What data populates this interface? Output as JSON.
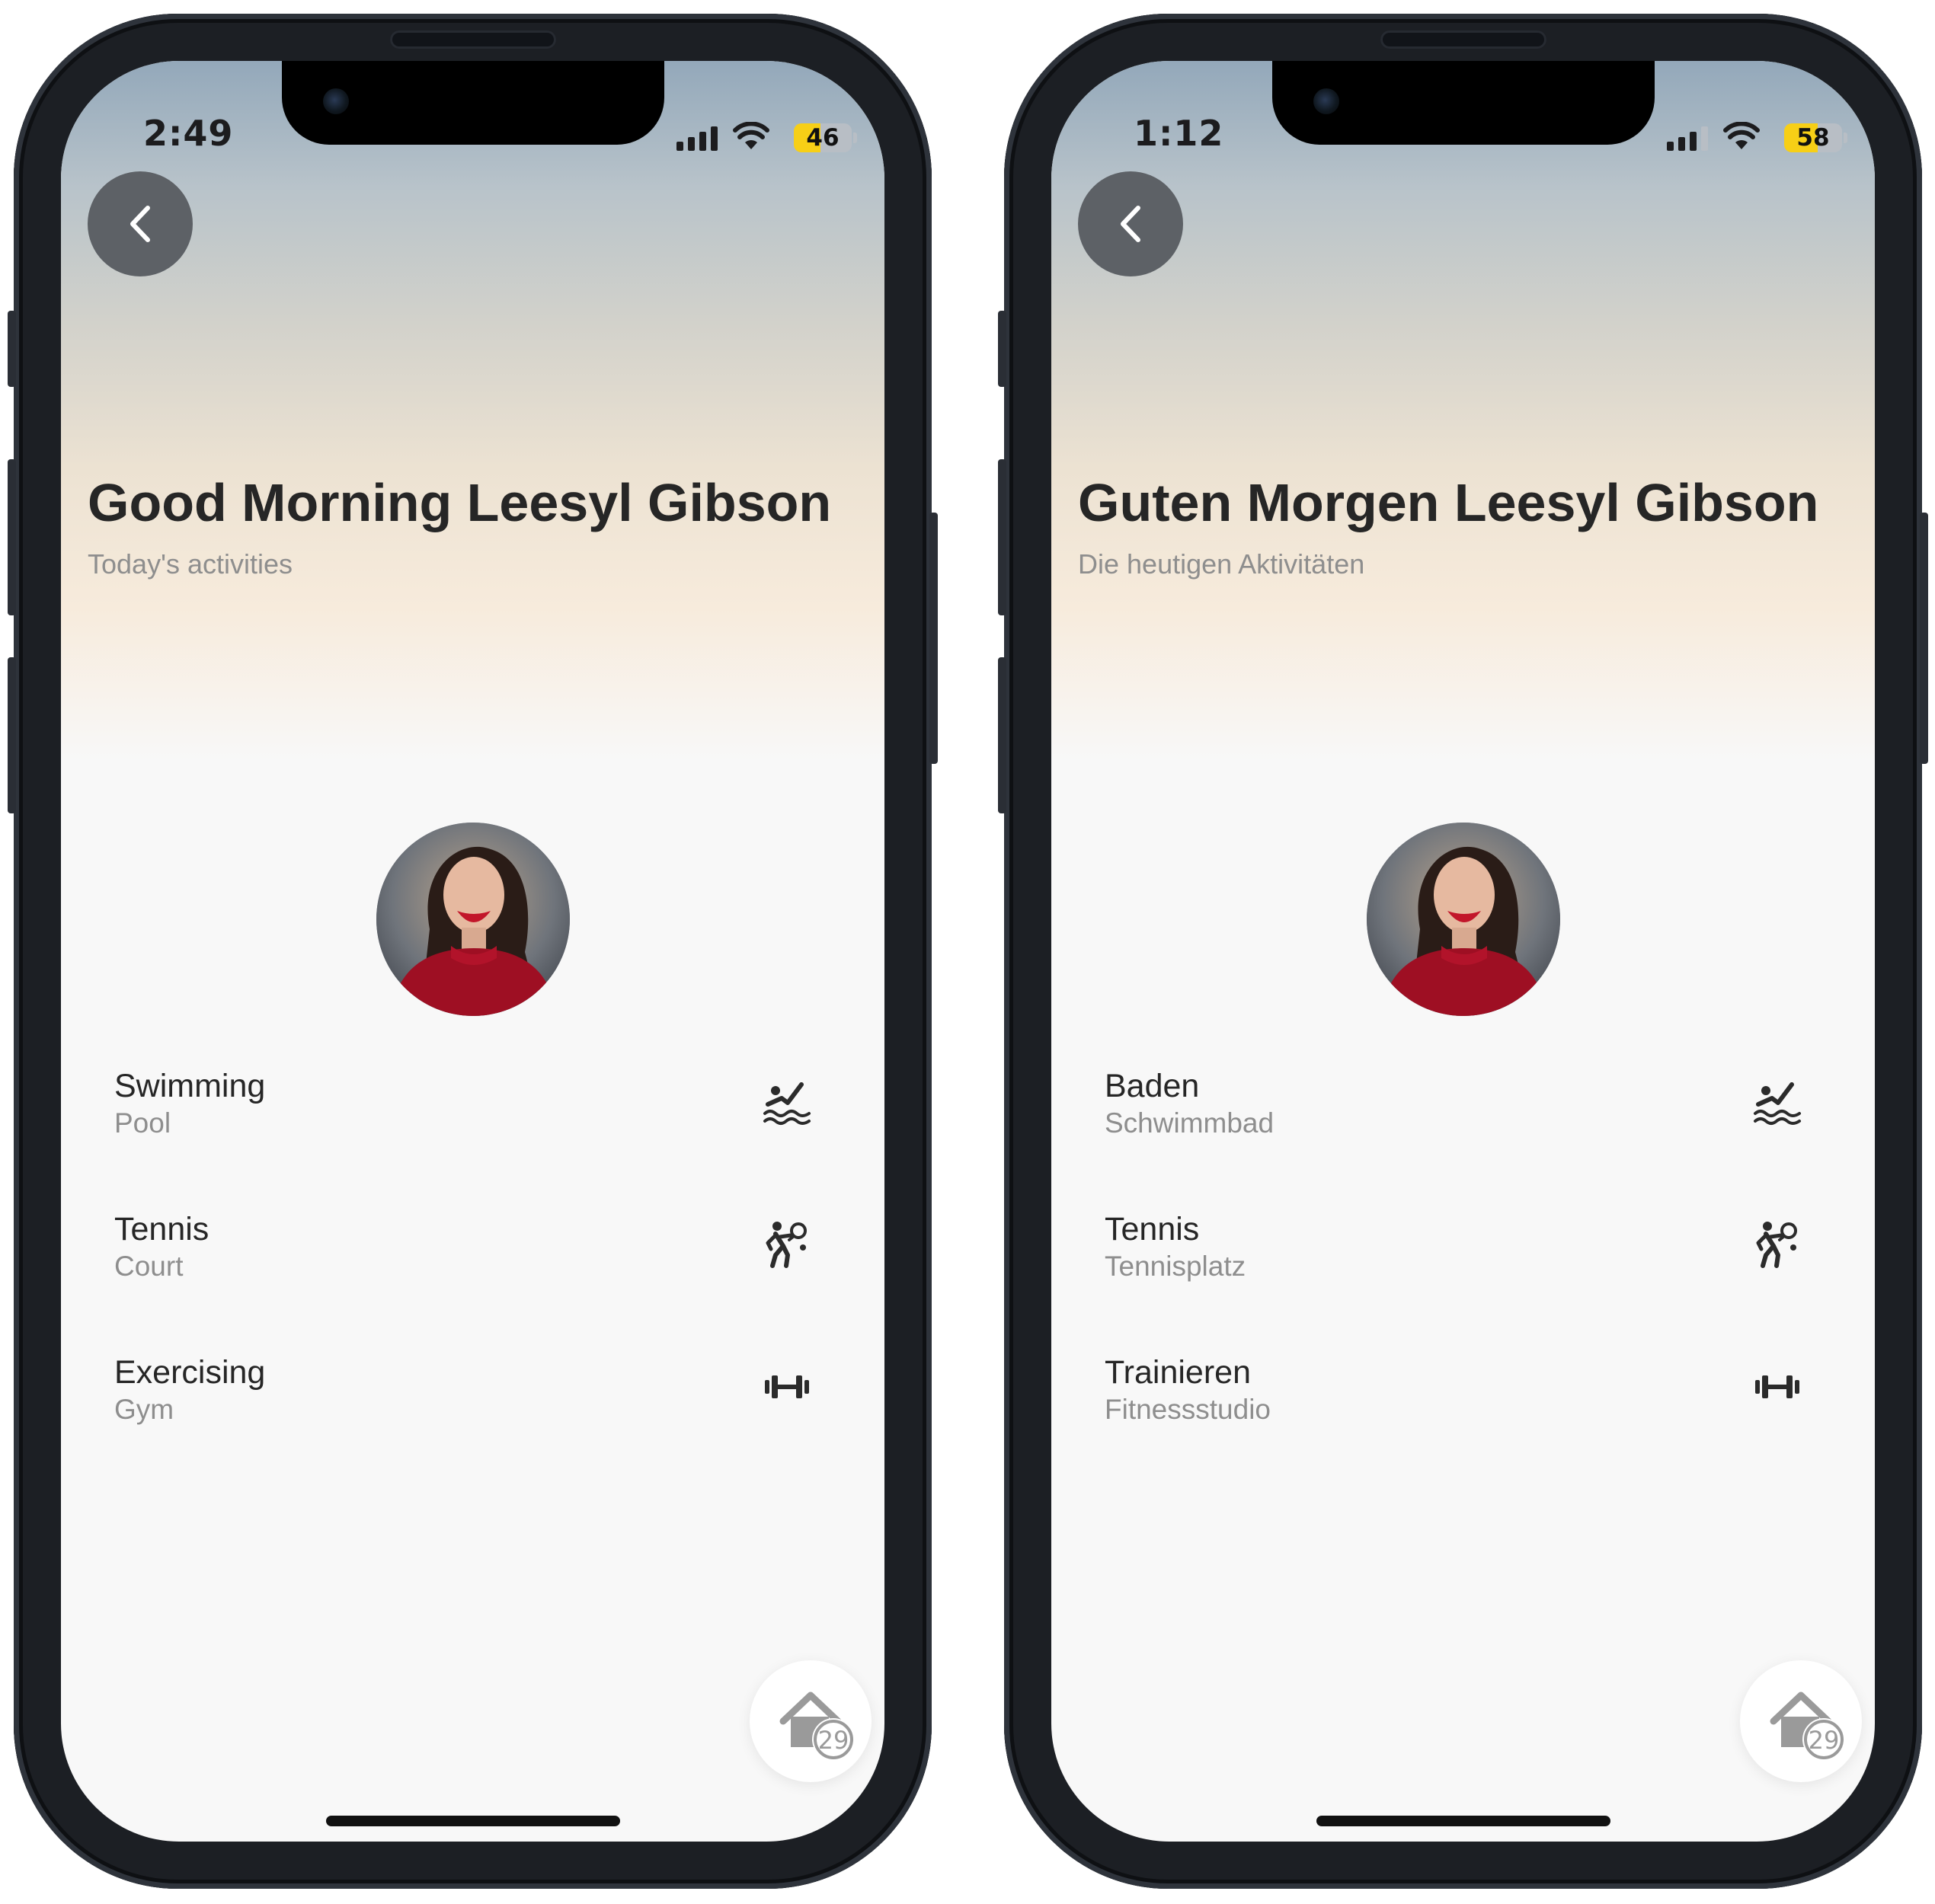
{
  "phones": [
    {
      "status": {
        "time": "2:49",
        "battery": "46",
        "battery_level": 46
      },
      "greeting": "Good Morning Leesyl Gibson",
      "subtitle": "Today's activities",
      "activities": [
        {
          "title": "Swimming",
          "place": "Pool",
          "icon": "swimming-icon"
        },
        {
          "title": "Tennis",
          "place": "Court",
          "icon": "tennis-icon"
        },
        {
          "title": "Exercising",
          "place": "Gym",
          "icon": "dumbbell-icon"
        }
      ],
      "home_badge": "29"
    },
    {
      "status": {
        "time": "1:12",
        "battery": "58",
        "battery_level": 58
      },
      "greeting": "Guten Morgen Leesyl Gibson",
      "subtitle": "Die heutigen Aktivitäten",
      "activities": [
        {
          "title": "Baden",
          "place": "Schwimmbad",
          "icon": "swimming-icon"
        },
        {
          "title": "Tennis",
          "place": "Tennisplatz",
          "icon": "tennis-icon"
        },
        {
          "title": "Trainieren",
          "place": "Fitnessstudio",
          "icon": "dumbbell-icon"
        }
      ],
      "home_badge": "29"
    }
  ],
  "colors": {
    "battery_fill": "#f7cf16",
    "title_text": "#262626",
    "secondary_text": "#8e8e8e",
    "back_button": "#5d6166"
  }
}
